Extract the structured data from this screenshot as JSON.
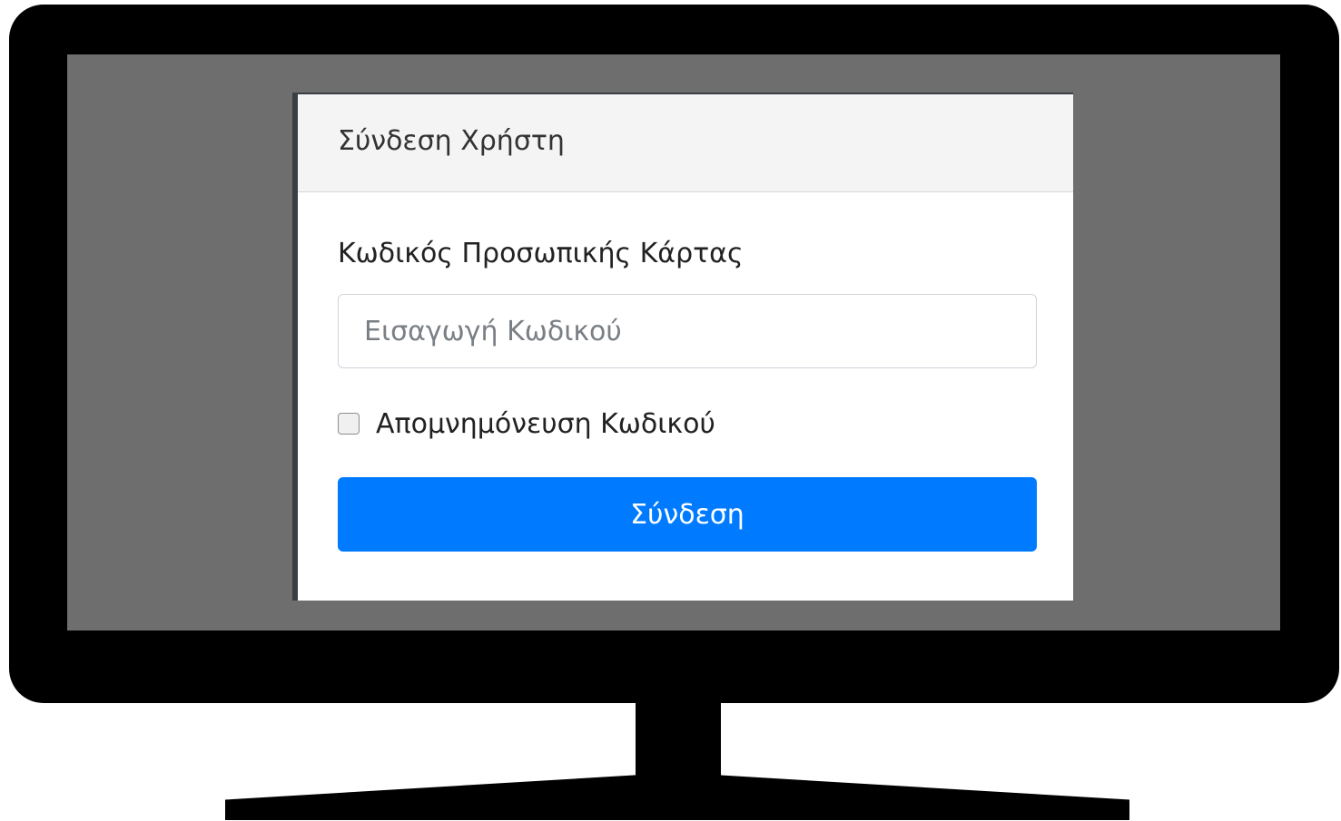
{
  "login_card": {
    "title": "Σύνδεση Χρήστη",
    "code_label": "Κωδικός Προσωπικής Κάρτας",
    "code_input": {
      "value": "",
      "placeholder": "Εισαγωγή Κωδικού"
    },
    "remember": {
      "label": "Απομνημόνευση Κωδικού",
      "checked": false
    },
    "submit_label": "Σύνδεση"
  },
  "colors": {
    "accent": "#007bff",
    "screen_background": "#6e6e6e",
    "monitor_frame": "#000000"
  }
}
